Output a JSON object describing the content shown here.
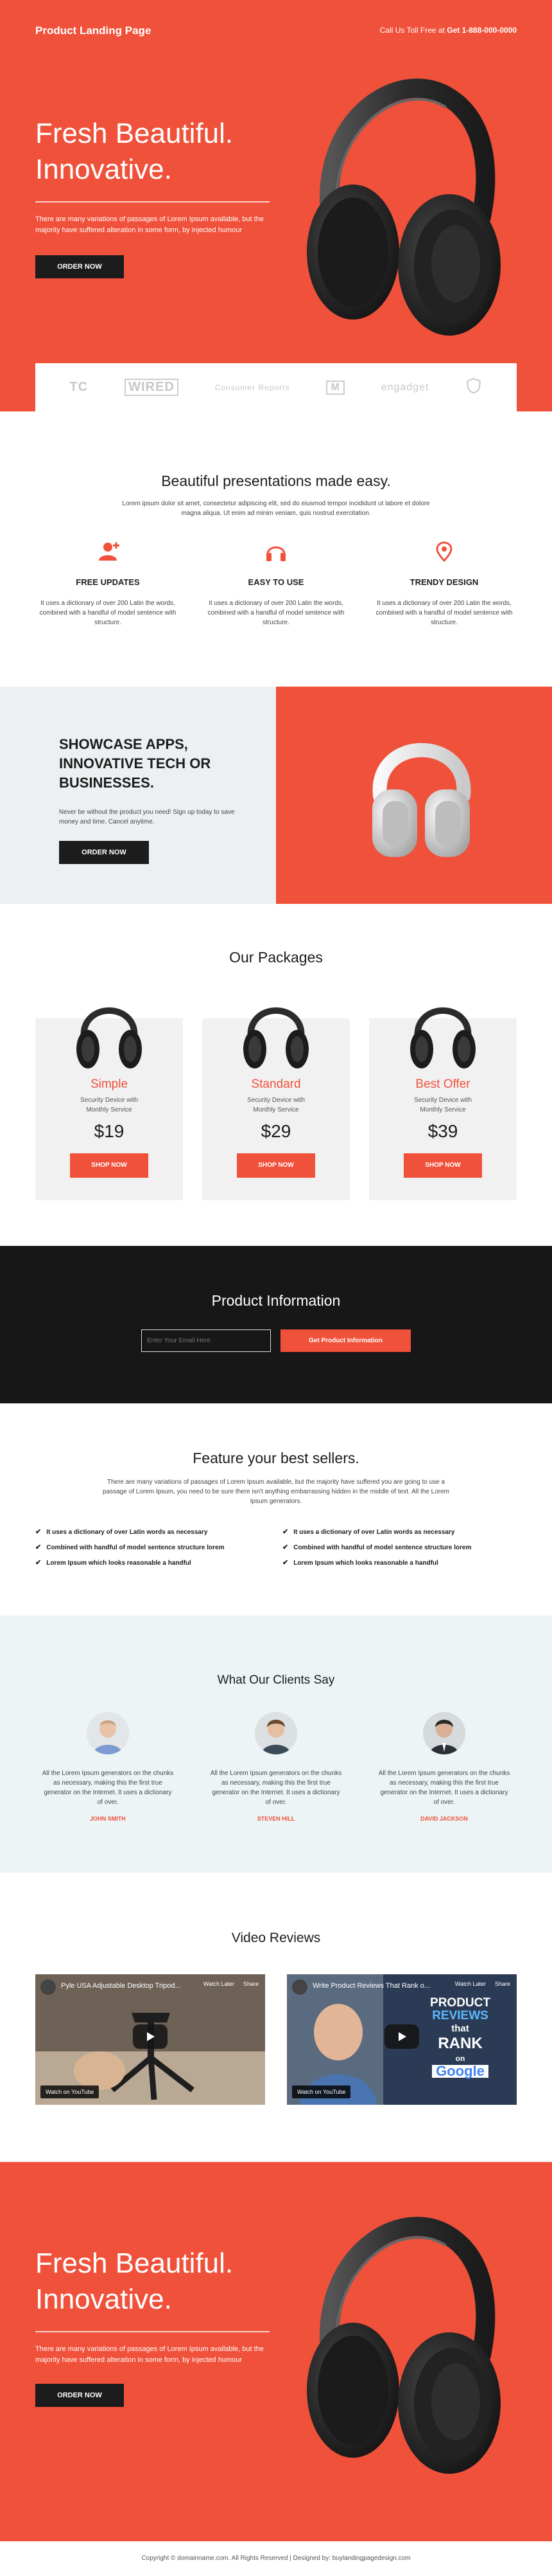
{
  "header": {
    "logo": "Product Landing Page",
    "call_label": "Call Us Toll Free at",
    "phone": "Get 1-888-000-0000"
  },
  "hero": {
    "title": "Fresh Beautiful. Innovative.",
    "text": "There are many variations of passages of Lorem Ipsum available, but the majority have suffered alteration in some form, by injected humour",
    "order_label": "ORDER NOW"
  },
  "press_logos": [
    "TC",
    "WIRED",
    "Consumer Reports",
    "M",
    "engadget",
    "shield-logo"
  ],
  "features": {
    "title": "Beautiful presentations made easy.",
    "text": "Lorem ipsum dolor sit amet, consectetur adipiscing elit, sed do eiusmod tempor incididunt ut labore et dolore magna aliqua. Ut enim ad minim veniam, quis nostrud exercitation.",
    "items": [
      {
        "icon": "user-add-icon",
        "title": "FREE UPDATES",
        "text": "It uses a dictionary of over 200 Latin the words, combined with a handful of model sentence with structure."
      },
      {
        "icon": "headphones-icon",
        "title": "EASY TO USE",
        "text": "It uses a dictionary of over 200 Latin the words, combined with a handful of model sentence with structure."
      },
      {
        "icon": "location-pin-icon",
        "title": "TRENDY DESIGN",
        "text": "It uses a dictionary of over 200 Latin the words, combined with a handful of model sentence with structure."
      }
    ]
  },
  "showcase": {
    "title": "SHOWCASE APPS, INNOVATIVE TECH OR BUSINESSES.",
    "text": "Never be without the product you need! Sign up today to save money and time. Cancel anytime.",
    "order_label": "ORDER NOW"
  },
  "packages": {
    "title": "Our Packages",
    "items": [
      {
        "name": "Simple",
        "desc": "Security Device with Monthly Service",
        "price": "$19",
        "button": "SHOP NOW"
      },
      {
        "name": "Standard",
        "desc": "Security Device with Monthly Service",
        "price": "$29",
        "button": "SHOP NOW"
      },
      {
        "name": "Best Offer",
        "desc": "Security Device with Monthly Service",
        "price": "$39",
        "button": "SHOP NOW"
      }
    ]
  },
  "info": {
    "title": "Product Information",
    "email_placeholder": "Enter Your Email Here",
    "button": "Get Product Information"
  },
  "bestsellers": {
    "title": "Feature your best sellers.",
    "text": "There are many variations of passages of Lorem Ipsum available, but the majority have suffered you are going to use a passage of Lorem Ipsum, you need to be sure there isn't anything embarrassing hidden in the middle of text. All the Lorem Ipsum generators.",
    "left": [
      "It uses a dictionary of over Latin words as necessary",
      "Combined with handful of model sentence structure lorem",
      "Lorem Ipsum which looks reasonable a handful"
    ],
    "right": [
      "It uses a dictionary of over Latin words as necessary",
      "Combined with handful of model sentence structure lorem",
      "Lorem Ipsum which looks reasonable a handful"
    ]
  },
  "clients": {
    "title": "What Our Clients Say",
    "items": [
      {
        "text": "All the Lorem Ipsum generators on the chunks as necessary, making this the first true generator on the Internet. It uses a dictionary of over.",
        "name": "JOHN SMITH"
      },
      {
        "text": "All the Lorem Ipsum generators on the chunks as necessary, making this the first true generator on the Internet. It uses a dictionary of over.",
        "name": "STEVEN HILL"
      },
      {
        "text": "All the Lorem Ipsum generators on the chunks as necessary, making this the first true generator on the Internet. It uses a dictionary of over.",
        "name": "DAVID JACKSON"
      }
    ]
  },
  "videos": {
    "title": "Video Reviews",
    "items": [
      {
        "title": "Pyle USA Adjustable Desktop Tripod...",
        "watch": "Watch on YouTube",
        "watch_later": "Watch Later",
        "share": "Share"
      },
      {
        "title": "Write Product Reviews That Rank o...",
        "watch": "Watch on YouTube",
        "watch_later": "Watch Later",
        "share": "Share",
        "overlay": [
          "PRODUCT",
          "REVIEWS",
          "that",
          "RANK",
          "on",
          "Google"
        ]
      }
    ]
  },
  "hero2": {
    "title": "Fresh Beautiful. Innovative.",
    "text": "There are many variations of passages of Lorem Ipsum available, but the majority have suffered alteration in some form, by injected humour",
    "order_label": "ORDER NOW"
  },
  "footer": {
    "text": "Copyright © domainname.com. All Rights Reserved | Designed by: buylandingpagedesign.com"
  },
  "colors": {
    "accent": "#f0513b",
    "dark": "#1c1c1c",
    "light_bg": "#edf0f2"
  }
}
